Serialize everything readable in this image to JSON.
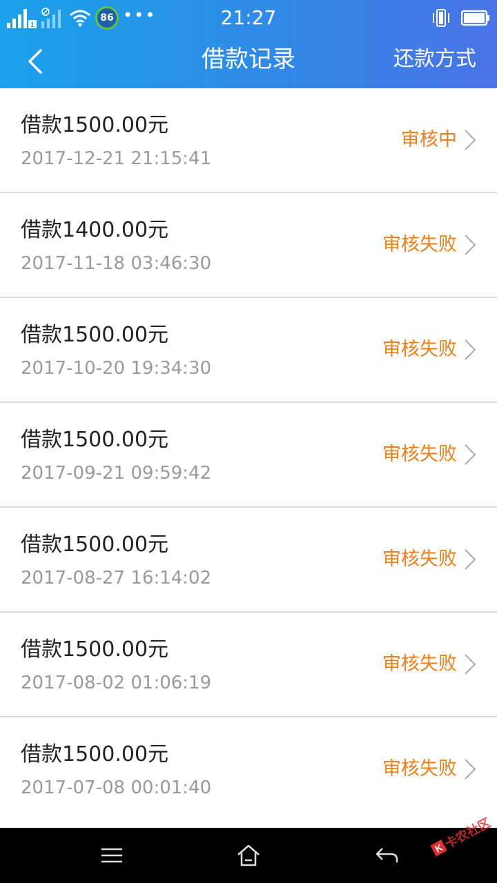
{
  "status_bar": {
    "time": "21:27",
    "badge": "86",
    "dots": "•••",
    "sim_label": "1",
    "icons": [
      "signal-icon",
      "wifi-icon",
      "vibrate-icon",
      "battery-icon"
    ]
  },
  "header": {
    "title": "借款记录",
    "right_action": "还款方式",
    "back_icon": "chevron-left-icon"
  },
  "records": [
    {
      "amount": "借款1500.00元",
      "time": "2017-12-21 21:15:41",
      "status": "审核中"
    },
    {
      "amount": "借款1400.00元",
      "time": "2017-11-18 03:46:30",
      "status": "审核失败"
    },
    {
      "amount": "借款1500.00元",
      "time": "2017-10-20 19:34:30",
      "status": "审核失败"
    },
    {
      "amount": "借款1500.00元",
      "time": "2017-09-21 09:59:42",
      "status": "审核失败"
    },
    {
      "amount": "借款1500.00元",
      "time": "2017-08-27 16:14:02",
      "status": "审核失败"
    },
    {
      "amount": "借款1500.00元",
      "time": "2017-08-02 01:06:19",
      "status": "审核失败"
    },
    {
      "amount": "借款1500.00元",
      "time": "2017-07-08 00:01:40",
      "status": "审核失败"
    }
  ],
  "colors": {
    "header_start": "#1aa2ea",
    "header_end": "#4a73e6",
    "status_text": "#f07e1a",
    "time_text": "#9a9a9a"
  },
  "bottom_nav": {
    "icons": [
      "menu-icon",
      "home-icon",
      "back-arrow-icon"
    ]
  },
  "watermark": {
    "text": "卡农社区"
  }
}
